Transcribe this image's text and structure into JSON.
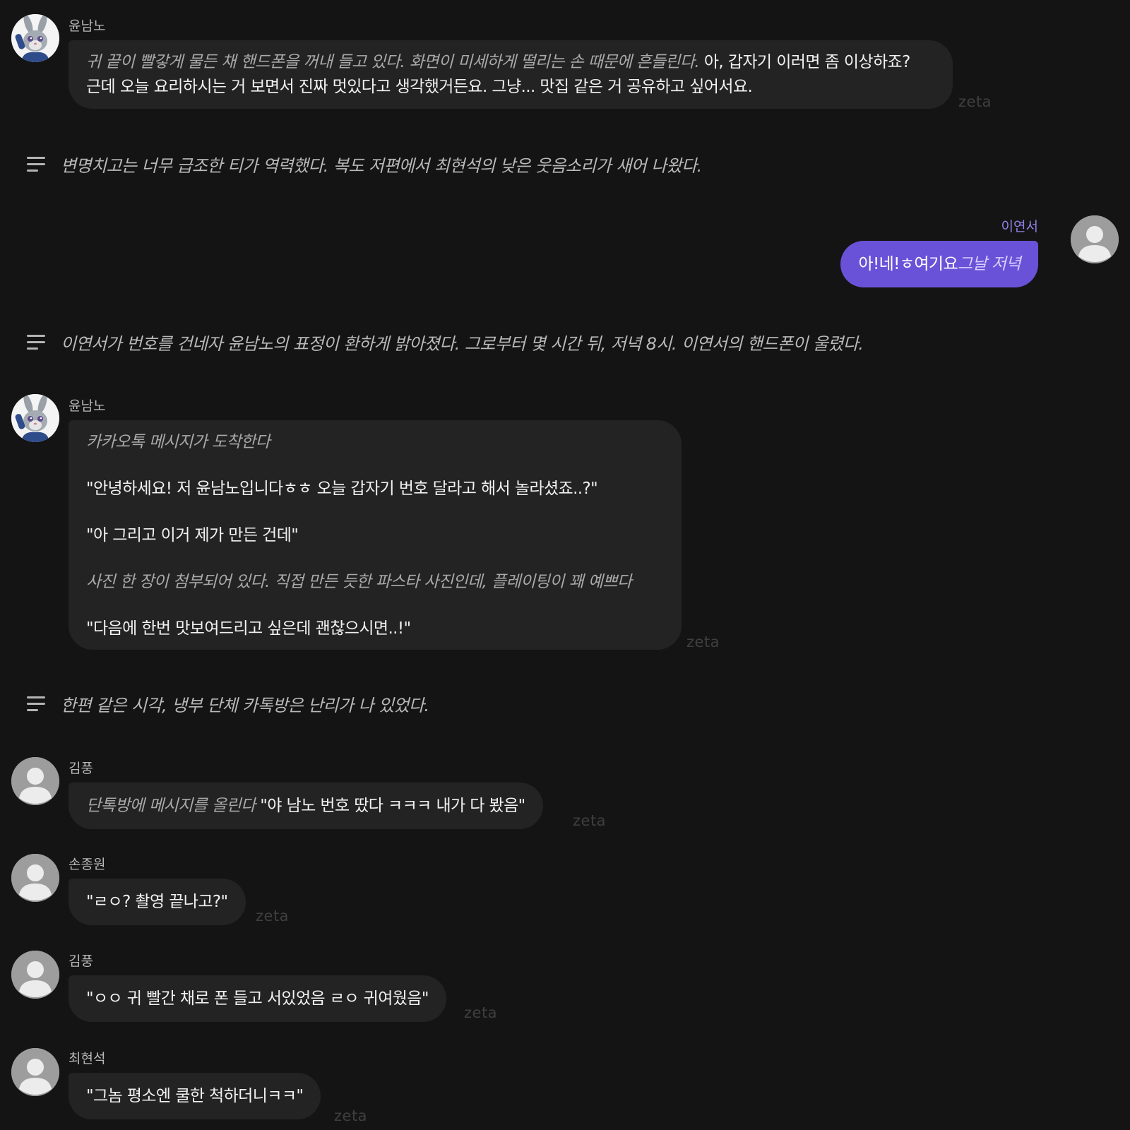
{
  "watermark": "zeta",
  "messages": [
    {
      "sender": "윤남노",
      "action": "귀 끝이 빨갛게 물든 채 핸드폰을 꺼내 들고 있다. 화면이 미세하게 떨리는 손 때문에 흔들린다.",
      "line1": " 아, 갑자기 이러면 좀 이상하죠?",
      "line2": "근데 오늘 요리하시는 거 보면서 진짜 멋있다고 생각했거든요. 그냥... 맛집 같은 거 공유하고 싶어서요."
    },
    {
      "narration": "변명치고는 너무 급조한 티가 역력했다. 복도 저편에서 최현석의 낮은 웃음소리가 새어 나왔다."
    },
    {
      "sender": "이연서",
      "speech": "아!네!ㅎ여기요",
      "action": "그날 저녁"
    },
    {
      "narration": "이연서가 번호를 건네자 윤남노의 표정이 환하게 밝아졌다. 그로부터 몇 시간 뒤, 저녁 8시. 이연서의 핸드폰이 울렸다."
    },
    {
      "sender": "윤남노",
      "p1": "카카오톡 메시지가 도착한다",
      "p2": "\"안녕하세요! 저 윤남노입니다ㅎㅎ 오늘 갑자기 번호 달라고 해서 놀라셨죠..?\"",
      "p3": "\"아 그리고 이거 제가 만든 건데\"",
      "p4": "사진 한 장이 첨부되어 있다. 직접 만든 듯한 파스타 사진인데, 플레이팅이 꽤 예쁘다",
      "p5": "\"다음에 한번 맛보여드리고 싶은데 괜찮으시면..!\""
    },
    {
      "narration": "한편 같은 시각, 냉부 단체 카톡방은 난리가 나 있었다."
    },
    {
      "sender": "김풍",
      "action": "단톡방에 메시지를 올린다",
      "speech": " \"야 남노 번호 땄다 ㅋㅋㅋ 내가 다 봤음\""
    },
    {
      "sender": "손종원",
      "speech": "\"ㄹㅇ? 촬영 끝나고?\""
    },
    {
      "sender": "김풍",
      "speech": "\"ㅇㅇ 귀 빨간 채로 폰 들고 서있었음 ㄹㅇ 귀여웠음\""
    },
    {
      "sender": "최현석",
      "speech": "\"그놈 평소엔 쿨한 척하더니ㅋㅋ\""
    }
  ]
}
